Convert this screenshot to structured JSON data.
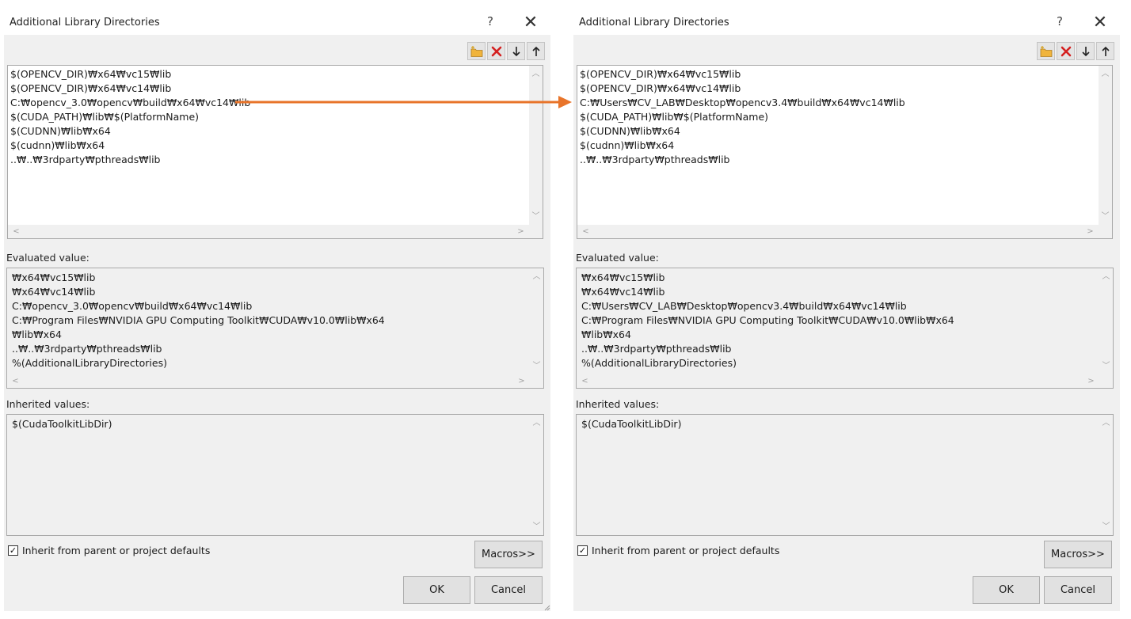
{
  "colors": {
    "dialog_bg": "#f0f0f0",
    "annotation_arrow": "#e8742a",
    "delete_icon": "#d42020",
    "folder_icon": "#f0b43c"
  },
  "icons": [
    "new-line-icon",
    "delete-icon",
    "move-down-icon",
    "move-up-icon",
    "help-icon",
    "close-icon",
    "checkmark-icon"
  ],
  "left": {
    "title": "Additional Library Directories",
    "help": "?",
    "close": "✕",
    "directories": [
      "$(OPENCV_DIR)₩x64₩vc15₩lib",
      "$(OPENCV_DIR)₩x64₩vc14₩lib",
      "C:₩opencv_3.0₩opencv₩build₩x64₩vc14₩lib",
      "$(CUDA_PATH)₩lib₩$(PlatformName)",
      "$(CUDNN)₩lib₩x64",
      "$(cudnn)₩lib₩x64",
      "..₩..₩3rdparty₩pthreads₩lib"
    ],
    "evaluated_label": "Evaluated value:",
    "evaluated": [
      "₩x64₩vc15₩lib",
      "₩x64₩vc14₩lib",
      "C:₩opencv_3.0₩opencv₩build₩x64₩vc14₩lib",
      "C:₩Program Files₩NVIDIA GPU Computing Toolkit₩CUDA₩v10.0₩lib₩x64",
      "₩lib₩x64",
      "..₩..₩3rdparty₩pthreads₩lib",
      "%(AdditionalLibraryDirectories)"
    ],
    "inherited_label": "Inherited values:",
    "inherited": [
      "$(CudaToolkitLibDir)"
    ],
    "inherit_checkbox": "Inherit from parent or project defaults",
    "inherit_checked": true,
    "macros_button": "Macros>>",
    "ok_button": "OK",
    "cancel_button": "Cancel"
  },
  "right": {
    "title": "Additional Library Directories",
    "help": "?",
    "close": "✕",
    "directories": [
      "$(OPENCV_DIR)₩x64₩vc15₩lib",
      "$(OPENCV_DIR)₩x64₩vc14₩lib",
      "C:₩Users₩CV_LAB₩Desktop₩opencv3.4₩build₩x64₩vc14₩lib",
      "$(CUDA_PATH)₩lib₩$(PlatformName)",
      "$(CUDNN)₩lib₩x64",
      "$(cudnn)₩lib₩x64",
      "..₩..₩3rdparty₩pthreads₩lib"
    ],
    "evaluated_label": "Evaluated value:",
    "evaluated": [
      "₩x64₩vc15₩lib",
      "₩x64₩vc14₩lib",
      "C:₩Users₩CV_LAB₩Desktop₩opencv3.4₩build₩x64₩vc14₩lib",
      "C:₩Program Files₩NVIDIA GPU Computing Toolkit₩CUDA₩v10.0₩lib₩x64",
      "₩lib₩x64",
      "..₩..₩3rdparty₩pthreads₩lib",
      "%(AdditionalLibraryDirectories)"
    ],
    "inherited_label": "Inherited values:",
    "inherited": [
      "$(CudaToolkitLibDir)"
    ],
    "inherit_checkbox": "Inherit from parent or project defaults",
    "inherit_checked": true,
    "macros_button": "Macros>>",
    "ok_button": "OK",
    "cancel_button": "Cancel"
  }
}
